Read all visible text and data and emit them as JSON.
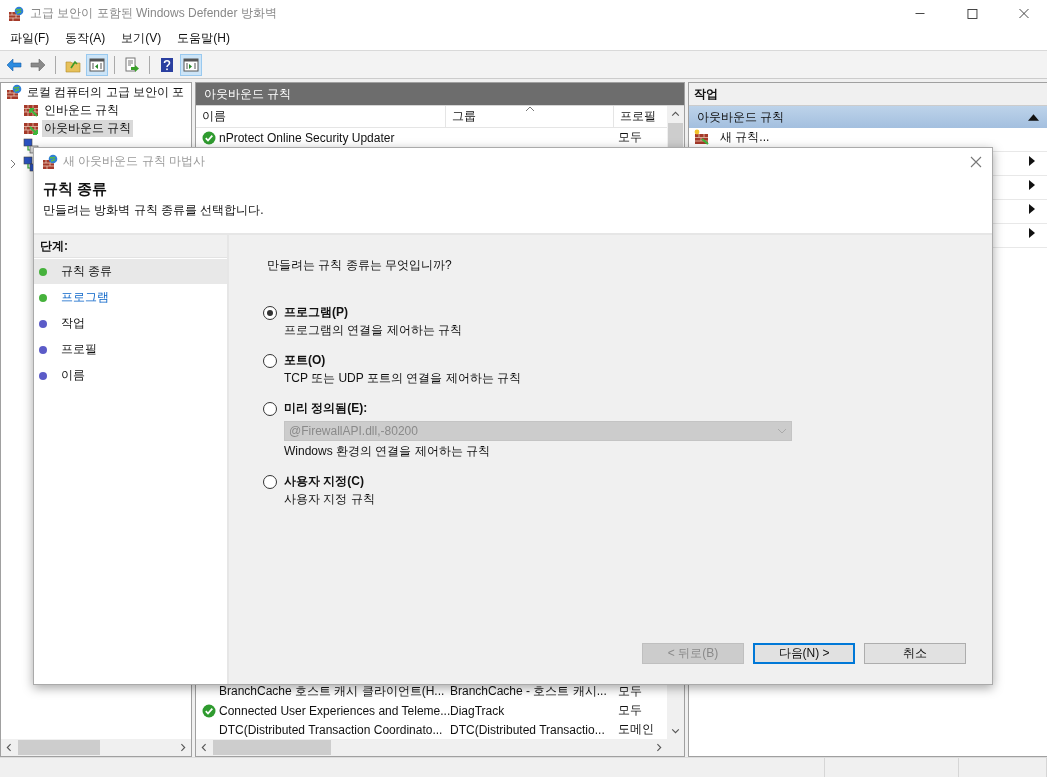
{
  "window": {
    "title": "고급 보안이 포함된 Windows Defender 방화벽"
  },
  "menu": [
    "파일(F)",
    "동작(A)",
    "보기(V)",
    "도움말(H)"
  ],
  "toolbar_groups": [
    [
      {
        "kind": "back",
        "pressed": false
      },
      {
        "kind": "forward",
        "pressed": false
      }
    ],
    [
      {
        "kind": "up",
        "pressed": false
      },
      {
        "kind": "console-tree",
        "pressed": true
      }
    ],
    [
      {
        "kind": "export",
        "pressed": false
      }
    ],
    [
      {
        "kind": "help",
        "pressed": false
      },
      {
        "kind": "action-pane",
        "pressed": true
      }
    ]
  ],
  "tree": {
    "label": "로컬 컴퓨터의 고급 보안이 포",
    "children": [
      {
        "label": "인바운드 규칙",
        "kind": "inbound",
        "selected": false
      },
      {
        "label": "아웃바운드 규칙",
        "kind": "outbound",
        "selected": true
      },
      {
        "kind": "connection"
      },
      {
        "kind": "monitor",
        "expanded": false
      }
    ]
  },
  "rules": {
    "title": "아웃바운드 규칙",
    "columns": [
      {
        "label": "이름",
        "sorted": false
      },
      {
        "label": "그룹",
        "sorted": true
      },
      {
        "label": "프로필",
        "sorted": false
      }
    ],
    "rows_top": [
      {
        "name": "nProtect Online Security Updater",
        "profile": "모두",
        "enabled": true
      }
    ],
    "rows_bottom": [
      {
        "name": "BranchCache 호스트 캐시 클라이언트(H...",
        "group": "BranchCache - 호스트 캐시...",
        "profile": "모두",
        "enabled": false
      },
      {
        "name": "Connected User Experiences and Teleme...",
        "group": "DiagTrack",
        "profile": "모두",
        "enabled": true
      },
      {
        "name": "DTC(Distributed Transaction Coordinato...",
        "group": "DTC(Distributed Transactio...",
        "profile": "도메인",
        "enabled": false
      }
    ]
  },
  "actions": {
    "title": "작업",
    "section": {
      "label": "아웃바운드 규칙",
      "expanded": true
    },
    "items": [
      {
        "label": "새 규칙...",
        "submenu": false
      },
      {
        "submenu": true
      },
      {
        "submenu": true
      },
      {
        "submenu": true
      },
      {
        "submenu": true
      }
    ]
  },
  "dialog": {
    "title": "새 아웃바운드 규칙 마법사",
    "heading": "규칙 종류",
    "subheading": "만들려는 방화벽 규칙 종류를 선택합니다.",
    "steps_label": "단계:",
    "steps": [
      {
        "label": "규칙 종류",
        "selected": true,
        "link": false,
        "color": "#46b23c"
      },
      {
        "label": "프로그램",
        "selected": false,
        "link": true,
        "color": "#46b23c"
      },
      {
        "label": "작업",
        "selected": false,
        "link": false,
        "color": "#5b5bc8"
      },
      {
        "label": "프로필",
        "selected": false,
        "link": false,
        "color": "#5b5bc8"
      },
      {
        "label": "이름",
        "selected": false,
        "link": false,
        "color": "#5b5bc8"
      }
    ],
    "question": "만들려는 규칙 종류는 무엇입니까?",
    "options": [
      {
        "kind": "plain",
        "label": "프로그램(P)",
        "description": "프로그램의 연결을 제어하는 규칙",
        "selected": true
      },
      {
        "kind": "plain",
        "label": "포트(O)",
        "description": "TCP 또는 UDP 포트의 연결을 제어하는 규칙",
        "selected": false
      },
      {
        "kind": "dropdown",
        "label": "미리 정의됨(E):",
        "dropdown": {
          "value": "@FirewallAPI.dll,-80200",
          "disabled": true
        },
        "description": "Windows 환경의 연결을 제어하는 규칙",
        "selected": false
      },
      {
        "kind": "plain",
        "label": "사용자 지정(C)",
        "description": "사용자 지정 규칙",
        "selected": false
      }
    ],
    "buttons": [
      {
        "label": "< 뒤로(B)",
        "disabled": true,
        "default": false
      },
      {
        "label": "다음(N) >",
        "disabled": false,
        "default": true
      },
      {
        "label": "취소",
        "disabled": false,
        "default": false
      }
    ]
  }
}
